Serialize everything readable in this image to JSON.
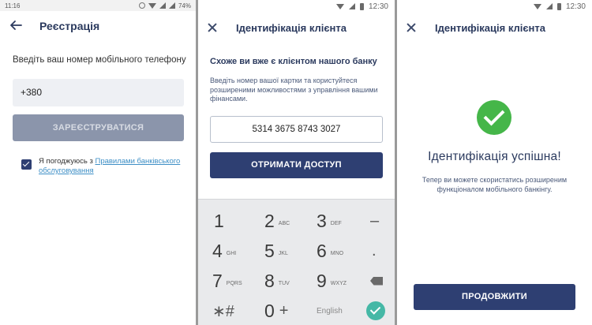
{
  "screen1": {
    "status": {
      "time": "11:16",
      "battery": "74%"
    },
    "title": "Реєстрація",
    "prompt": "Введіть ваш номер мобільного телефону",
    "phone_value": "+380",
    "register_label": "ЗАРЕЄСТРУВАТИСЯ",
    "agree_text": "Я погоджуюсь з ",
    "agree_link": "Правилами банківського обслуговування",
    "agree_checked": true
  },
  "screen2": {
    "status": {
      "time": "12:30"
    },
    "title": "Ідентифікація клієнта",
    "heading": "Схоже ви вже є клієнтом нашого банку",
    "description": "Введіть номер вашої картки та користуйтеся розширеними можливостями з управління вашими фінансами.",
    "card_value": "5314 3675 8743 3027",
    "access_label": "ОТРИМАТИ ДОСТУП",
    "keypad": {
      "keys": [
        {
          "digit": "1",
          "letters": ""
        },
        {
          "digit": "2",
          "letters": "ABC"
        },
        {
          "digit": "3",
          "letters": "DEF"
        },
        {
          "digit": "4",
          "letters": "GHI"
        },
        {
          "digit": "5",
          "letters": "JKL"
        },
        {
          "digit": "6",
          "letters": "MNO"
        },
        {
          "digit": "7",
          "letters": "PQRS"
        },
        {
          "digit": "8",
          "letters": "TUV"
        },
        {
          "digit": "9",
          "letters": "WXYZ"
        },
        {
          "digit": "0",
          "letters": "+"
        }
      ],
      "special_keys": {
        "star_hash": "∗#",
        "minus": "–",
        "dot": ".",
        "language": "English"
      }
    }
  },
  "screen3": {
    "status": {
      "time": "12:30"
    },
    "title": "Ідентифікація клієнта",
    "success_title": "Ідентифікація успішна!",
    "success_desc": "Тепер ви можете скористатись розширеним функціоналом мобільного банкінгу.",
    "continue_label": "ПРОДОВЖИТИ"
  },
  "colors": {
    "primary": "#2e3f72",
    "disabled_button": "#8b95ab",
    "success": "#45b649",
    "keypad_done": "#45b8a6",
    "link": "#3e8fc6"
  },
  "icons": [
    "back-arrow-icon",
    "close-icon",
    "checkbox-checked-icon",
    "success-check-icon",
    "backspace-icon",
    "done-check-icon",
    "wifi-icon",
    "signal-icon",
    "battery-icon",
    "alarm-icon"
  ]
}
